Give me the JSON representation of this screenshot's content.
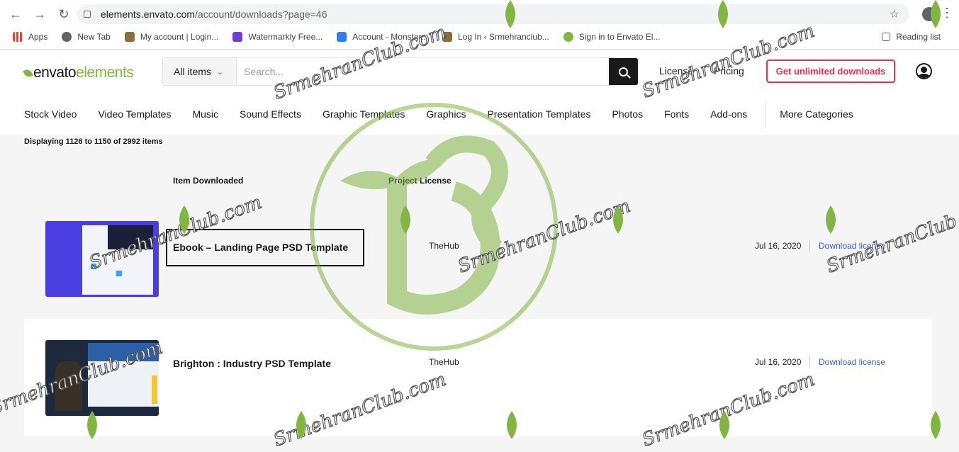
{
  "browser": {
    "url_host": "elements.envato.com",
    "url_path": "/account/downloads?page=46",
    "bookmarks": [
      {
        "label": "Apps"
      },
      {
        "label": "New Tab"
      },
      {
        "label": "My account | Login..."
      },
      {
        "label": "Watermarkly Free..."
      },
      {
        "label": "Account - Monster..."
      },
      {
        "label": "Log In ‹ Srmehranclub..."
      },
      {
        "label": "Sign in to Envato El..."
      }
    ],
    "reading_list": "Reading list"
  },
  "header": {
    "logo_main": "envato",
    "logo_accent": "elements",
    "search_category": "All items",
    "search_placeholder": "Search...",
    "links": {
      "license": "License",
      "pricing": "Pricing"
    },
    "cta": "Get unlimited downloads"
  },
  "categories": [
    "Stock Video",
    "Video Templates",
    "Music",
    "Sound Effects",
    "Graphic Templates",
    "Graphics",
    "Presentation Templates",
    "Photos",
    "Fonts",
    "Add-ons"
  ],
  "more_categories": "More Categories",
  "main": {
    "count_text": "Displaying 1126 to 1150 of 2992 items",
    "col_item": "Item Downloaded",
    "col_project": "Project License",
    "rows": [
      {
        "title": "Ebook – Landing Page PSD Template",
        "project": "TheHub",
        "date": "Jul 16, 2020",
        "download": "Download license"
      },
      {
        "title": "Brighton : Industry PSD Template",
        "project": "TheHub",
        "date": "Jul 16, 2020",
        "download": "Download license"
      }
    ]
  },
  "watermark": {
    "text": "SrmehranClub.com",
    "color": "#82b541"
  }
}
